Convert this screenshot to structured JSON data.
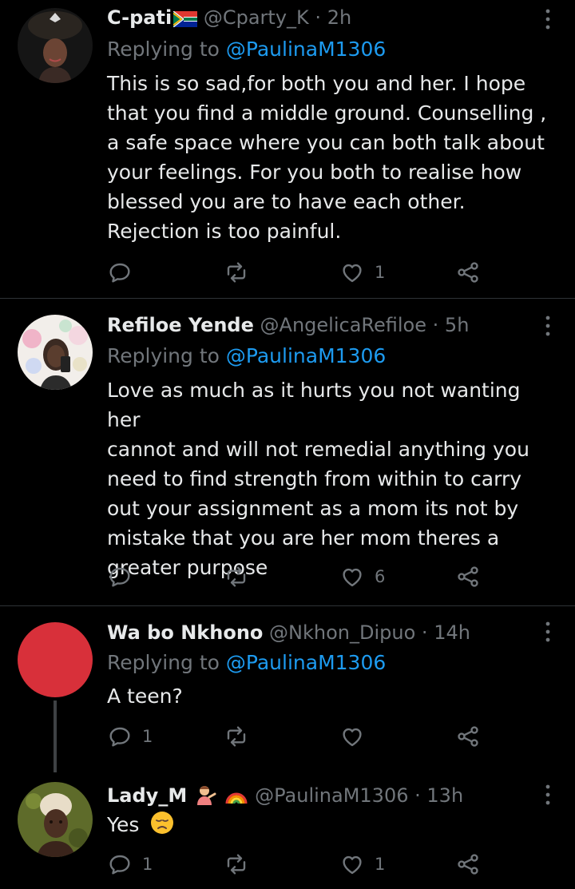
{
  "colors": {
    "background": "#000000",
    "text": "#e7e9ea",
    "muted": "#71767b",
    "link": "#1d9bf0",
    "divider": "#2f3336"
  },
  "tweets": [
    {
      "display_name": "C-pati",
      "name_emoji": "south-africa-flag",
      "handle": "@Cparty_K",
      "separator": "·",
      "time": "2h",
      "replying_prefix": "Replying to",
      "replying_to": "@PaulinaM1306",
      "lines": [
        "This is so sad,for both you and her. I hope",
        "that you find a middle ground. Counselling ,",
        "a safe space where you can both talk about",
        "your feelings. For you both to realise how",
        "blessed you are to have each other.",
        "Rejection is too painful."
      ],
      "reply_count": "",
      "retweet_count": "",
      "like_count": "1"
    },
    {
      "display_name": "Refiloe Yende",
      "handle": "@AngelicaRefiloe",
      "separator": "·",
      "time": "5h",
      "replying_prefix": "Replying to",
      "replying_to": "@PaulinaM1306",
      "lines": [
        "Love as much as it hurts you not wanting her",
        "cannot and will not remedial anything you",
        "need to find strength from within to carry",
        "out your assignment as a mom its not by",
        "mistake that you are her mom theres a",
        "greater purpose"
      ],
      "reply_count": "",
      "retweet_count": "",
      "like_count": "6"
    },
    {
      "display_name": "Wa bo Nkhono",
      "handle": "@Nkhon_Dipuo",
      "separator": "·",
      "time": "14h",
      "replying_prefix": "Replying to",
      "replying_to": "@PaulinaM1306",
      "lines": [
        "A teen?"
      ],
      "reply_count": "1",
      "retweet_count": "",
      "like_count": ""
    },
    {
      "display_name": "Lady_M",
      "name_emoji": "person-tipping-hand and rainbow",
      "handle": "@PaulinaM1306",
      "separator": "·",
      "time": "13h",
      "text": "Yes",
      "text_emoji": "disappointed-face",
      "reply_count": "1",
      "retweet_count": "",
      "like_count": "1"
    }
  ],
  "icons": {
    "reply": "reply-icon",
    "retweet": "retweet-icon",
    "like": "heart-icon",
    "share": "share-icon",
    "more": "more-options-icon"
  }
}
